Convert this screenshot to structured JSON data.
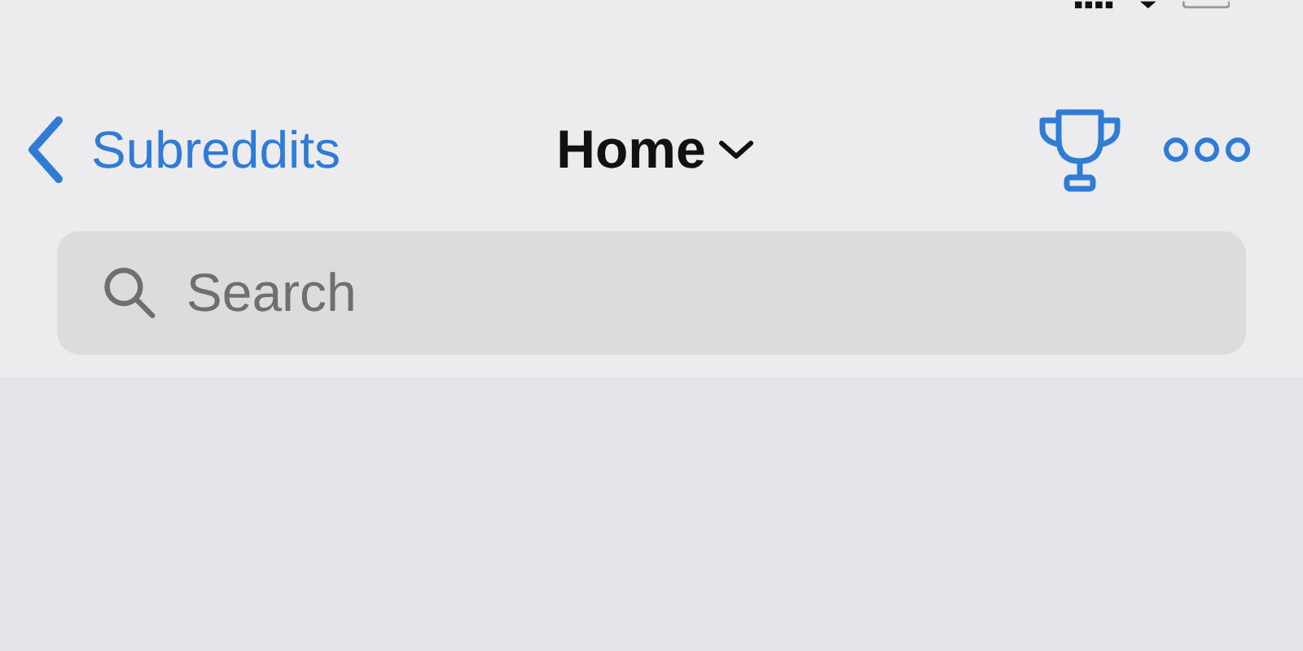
{
  "nav_bar": {
    "back_label": "Subreddits",
    "title": "Home"
  },
  "search": {
    "placeholder": "Search"
  }
}
